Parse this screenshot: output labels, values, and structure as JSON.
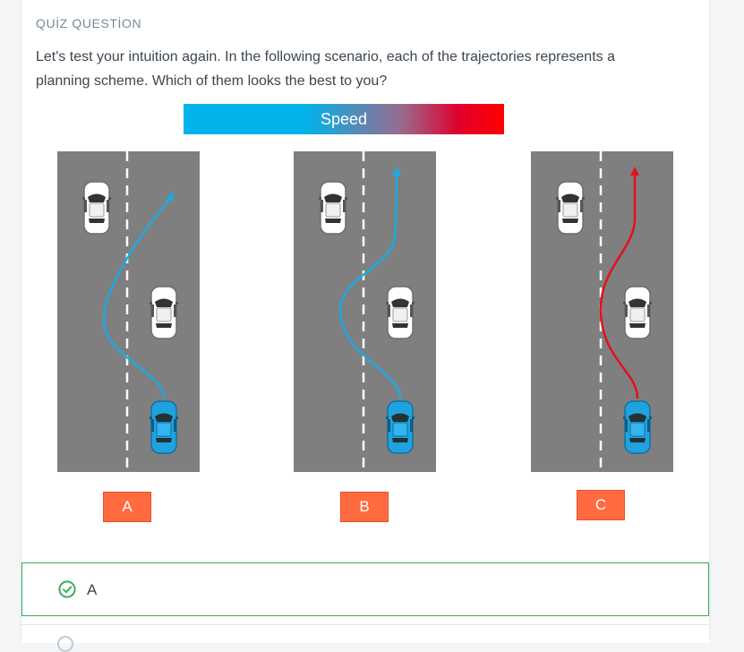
{
  "quiz": {
    "kicker": "QUİZ QUESTİON",
    "question": "Let's test your intuition again. In the following scenario, each of the trajectories represents a planning scheme. Which of them looks the best to you?",
    "legend_label": "Speed",
    "options": [
      {
        "label": "A"
      },
      {
        "label": "B"
      },
      {
        "label": "C"
      }
    ]
  },
  "answers": [
    {
      "label": "A",
      "state": "correct"
    }
  ],
  "colors": {
    "accent": "#ff6b3e",
    "correct": "#3aab5a",
    "trajectory_slow": "#1da9e1",
    "trajectory_fast": "#e2121b",
    "road": "#7f7f7f",
    "ego_car": "#1fa2e0"
  }
}
